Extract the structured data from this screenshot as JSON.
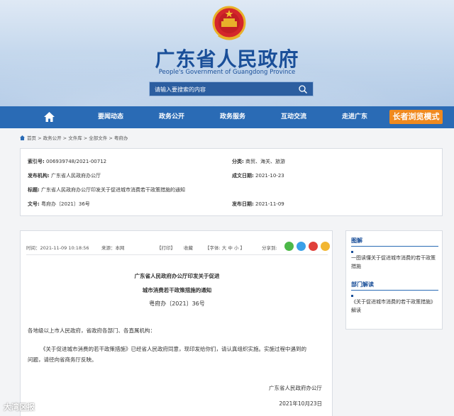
{
  "header": {
    "site_title": "广东省人民政府",
    "site_subtitle": "People's Government of Guangdong Province",
    "search_placeholder": "请输入要搜索的内容"
  },
  "nav": {
    "items": [
      "要闻动态",
      "政务公开",
      "政务服务",
      "互动交流",
      "走进广东"
    ],
    "elder_mode": "长者浏览模式"
  },
  "breadcrumb": [
    "首页",
    "政务公开",
    "文件库",
    "全部文件",
    "粤府办"
  ],
  "meta": {
    "index_label": "索引号:",
    "index_value": "006939748/2021-00712",
    "category_label": "分类:",
    "category_value": "商贸、海关、旅游",
    "issuer_label": "发布机构:",
    "issuer_value": "广东省人民政府办公厅",
    "created_label": "成文日期:",
    "created_value": "2021-10-23",
    "title_label": "标题:",
    "title_value": "广东省人民政府办公厅印发关于促进城市消费若干政策措施的通知",
    "docno_label": "文号:",
    "docno_value": "粤府办〔2021〕36号",
    "published_label": "发布日期:",
    "published_value": "2021-11-09"
  },
  "doc": {
    "time": "时间：2021-11-09 10:18:56",
    "source": "来源：本网",
    "print": "【打印】",
    "favorite": "收藏",
    "font_size": "【字体: 大   中   小 】",
    "share": "分享到:",
    "title_line1": "广东省人民政府办公厅印发关于促进",
    "title_line2": "城市消费若干政策措施的通知",
    "doc_number": "粤府办〔2021〕36号",
    "salutation": "各地级以上市人民政府，省政府各部门、各直属机构：",
    "body_line1": "《关于促进城市消费的若干政策措施》已经省人民政府同意，现印发给你们，请认真组织实施。实施过程中遇到的",
    "body_line2": "问题，请径向省商务厅反映。",
    "signer": "广东省人民政府办公厅",
    "sign_date": "2021年10月23日"
  },
  "sidebar": {
    "graphic_heading": "图解",
    "graphic_link": "一图读懂关于促进城市消费的若干政策措施",
    "dept_heading": "部门解读",
    "dept_link": "《关于促进城市消费的若干政策措施》解读"
  },
  "watermark": "大湾区报",
  "colors": {
    "nav": "#2a6bb5",
    "title": "#1a4f99",
    "elder_button": "#f08a1f"
  }
}
